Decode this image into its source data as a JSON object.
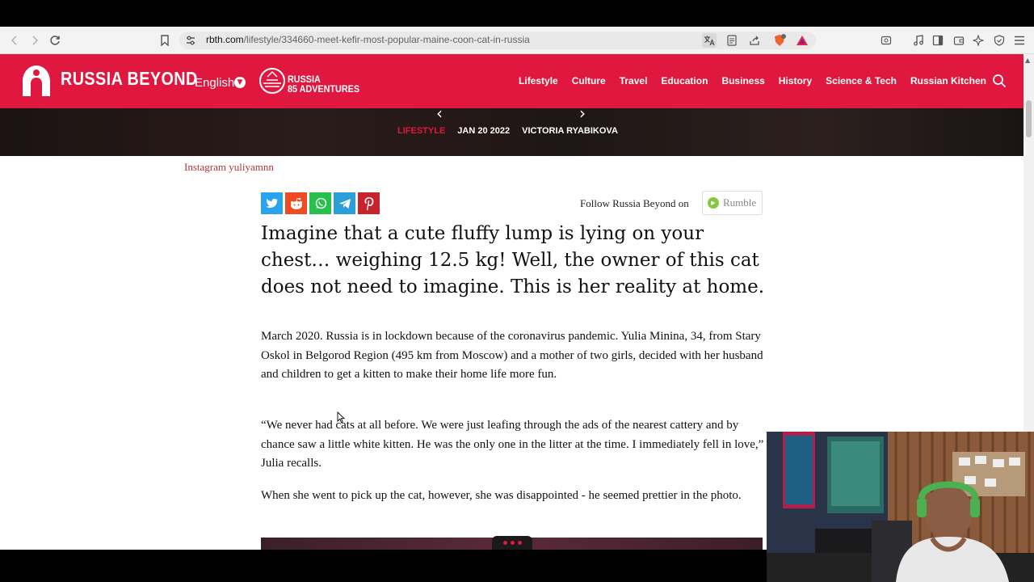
{
  "browser": {
    "url_host": "rbth.com",
    "url_path": "/lifestyle/334660-meet-kefir-most-popular-maine-coon-cat-in-russia",
    "colors": {
      "toolbar": "#f3f3f3",
      "urlbox": "#e9e9e9"
    }
  },
  "site": {
    "brand": "RUSSIA BEYOND",
    "language": "English",
    "promo_line1": "RUSSIA",
    "promo_line2": "85 ADVENTURES",
    "nav": [
      "Lifestyle",
      "Culture",
      "Travel",
      "Education",
      "Business",
      "History",
      "Science & Tech",
      "Russian Kitchen"
    ],
    "accent_color": "#e0183f"
  },
  "article": {
    "category": "LIFESTYLE",
    "date": "JAN 20 2022",
    "author": "VICTORIA RYABIKOVA",
    "photo_caption": "Instagram yuliyamnn",
    "share_icons": [
      "twitter-icon",
      "reddit-icon",
      "whatsapp-icon",
      "telegram-icon",
      "pinterest-icon"
    ],
    "follow_text": "Follow Russia Beyond on",
    "follow_platform": "Rumble",
    "lead": "Imagine that a cute fluffy lump is lying on your chest… weighing 12.5 kg! Well, the owner of this cat does not need to imagine. This is her reality at home.",
    "paragraphs": [
      "March 2020. Russia is in lockdown because of the coronavirus pandemic. Yulia Minina, 34, from Stary Oskol in Belgorod Region (495 km from Moscow) and a mother of two girls, decided with her husband and children to get a kitten to make their home life more fun.",
      "“We never had cats at all before. We were just leafing through the ads of the nearest cattery and by chance saw a little white kitten. He was the only one in the litter at the time. I immediately fell in love,” Julia recalls.",
      "When she went to pick up the cat, however, she was disappointed - he seemed prettier in the photo."
    ]
  }
}
